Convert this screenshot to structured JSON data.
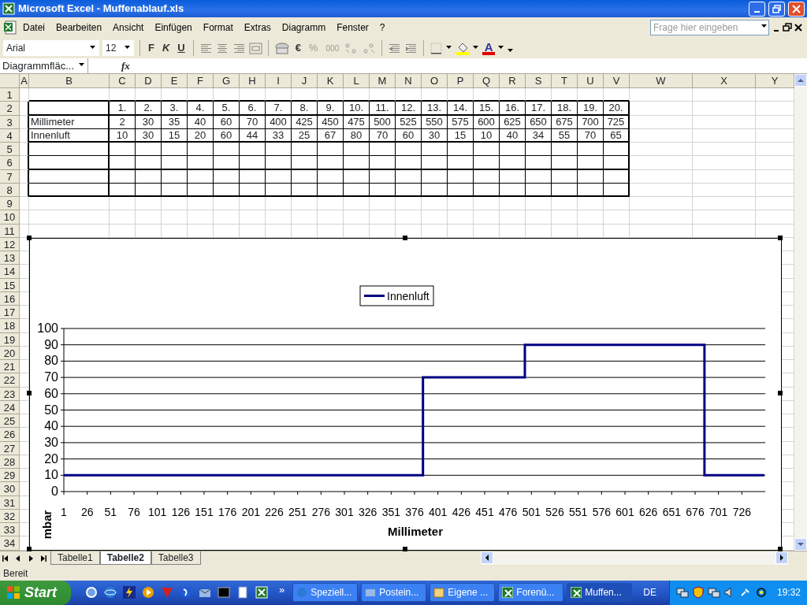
{
  "window": {
    "title": "Microsoft Excel - Muffenablauf.xls"
  },
  "menu": [
    "Datei",
    "Bearbeiten",
    "Ansicht",
    "Einfügen",
    "Format",
    "Extras",
    "Diagramm",
    "Fenster",
    "?"
  ],
  "help_box": {
    "placeholder": "Frage hier eingeben"
  },
  "toolbar": {
    "font": "Arial",
    "size": "12",
    "style_buttons": [
      "F",
      "K",
      "U"
    ],
    "number_buttons": [
      "€",
      "%",
      "000"
    ],
    "font_color_glyph": "A"
  },
  "formula_bar": {
    "name_box": "Diagrammfläc...",
    "fx": "fx"
  },
  "sheet": {
    "columns": [
      "A",
      "B",
      "C",
      "D",
      "E",
      "F",
      "G",
      "H",
      "I",
      "J",
      "K",
      "L",
      "M",
      "N",
      "O",
      "P",
      "Q",
      "R",
      "S",
      "T",
      "U",
      "V",
      "W",
      "X",
      "Y"
    ],
    "rows": [
      "1",
      "2",
      "3",
      "4",
      "5",
      "6",
      "7",
      "8",
      "9",
      "10",
      "11",
      "12",
      "13",
      "14",
      "15",
      "16",
      "17",
      "18",
      "19",
      "20",
      "21",
      "22",
      "23",
      "24",
      "25",
      "26",
      "27",
      "28",
      "29",
      "30",
      "31",
      "32",
      "33",
      "34"
    ],
    "table": {
      "header": [
        "1.",
        "2.",
        "3.",
        "4.",
        "5.",
        "6.",
        "7.",
        "8.",
        "9.",
        "10.",
        "11.",
        "12.",
        "13.",
        "14.",
        "15.",
        "16.",
        "17.",
        "18.",
        "19.",
        "20."
      ],
      "rows": [
        {
          "label": "Millimeter",
          "values": [
            "2",
            "30",
            "35",
            "40",
            "60",
            "70",
            "400",
            "425",
            "450",
            "475",
            "500",
            "525",
            "550",
            "575",
            "600",
            "625",
            "650",
            "675",
            "700",
            "725"
          ]
        },
        {
          "label": "Innenluft",
          "values": [
            "10",
            "30",
            "15",
            "20",
            "60",
            "44",
            "33",
            "25",
            "67",
            "80",
            "70",
            "60",
            "30",
            "15",
            "10",
            "40",
            "34",
            "55",
            "70",
            "65"
          ]
        }
      ]
    },
    "chart": {
      "chart_data": {
        "type": "line",
        "xlabel": "Millimeter",
        "ylabel": "mbar",
        "x": [
          1,
          385,
          385,
          494,
          494,
          686,
          686,
          750
        ],
        "series": [
          {
            "name": "Innenluft",
            "color": "#000080",
            "values": [
              10,
              10,
              70,
              70,
              90,
              90,
              10,
              10
            ]
          }
        ],
        "xlim": [
          1,
          751
        ],
        "ylim": [
          0,
          100
        ],
        "xticks": [
          1,
          26,
          51,
          76,
          101,
          126,
          151,
          176,
          201,
          226,
          251,
          276,
          301,
          326,
          351,
          376,
          401,
          426,
          451,
          476,
          501,
          526,
          551,
          576,
          601,
          626,
          651,
          676,
          701,
          726
        ],
        "yticks": [
          0,
          10,
          20,
          30,
          40,
          50,
          60,
          70,
          80,
          90,
          100
        ],
        "grid": true
      }
    }
  },
  "sheet_tabs": [
    {
      "label": "Tabelle1",
      "selected": false
    },
    {
      "label": "Tabelle2",
      "selected": true
    },
    {
      "label": "Tabelle3",
      "selected": false
    }
  ],
  "status_bar": "Bereit",
  "taskbar": {
    "start": "Start",
    "more": "»",
    "tasks": [
      {
        "label": "Speziell...",
        "selected": false
      },
      {
        "label": "Postein...",
        "selected": false
      },
      {
        "label": "Eigene ...",
        "selected": false
      },
      {
        "label": "Forenü...",
        "selected": false
      },
      {
        "label": "Muffen...",
        "selected": true
      }
    ],
    "language": "DE",
    "clock": "19:32"
  }
}
